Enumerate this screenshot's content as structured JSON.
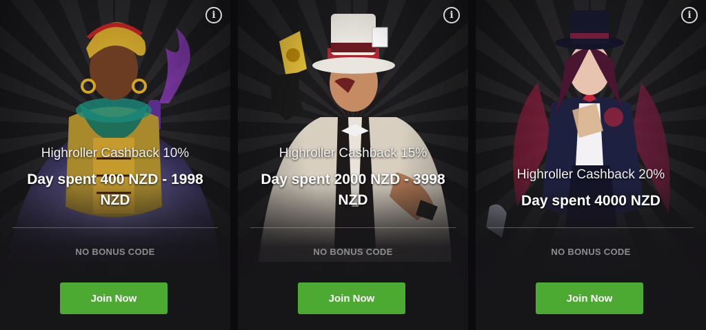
{
  "cards": [
    {
      "subtitle": "Highroller Cashback 10%",
      "title": "Day spent 400 NZD - 1998 NZD",
      "code_label": "NO BONUS CODE",
      "button_label": "Join Now",
      "info_icon": "i"
    },
    {
      "subtitle": "Highroller Cashback 15%",
      "title": "Day spent 2000 NZD - 3998 NZD",
      "code_label": "NO BONUS CODE",
      "button_label": "Join Now",
      "info_icon": "i"
    },
    {
      "subtitle": "Highroller Cashback 20%",
      "title": "Day spent 4000 NZD",
      "code_label": "NO BONUS CODE",
      "button_label": "Join Now",
      "info_icon": "i"
    }
  ],
  "colors": {
    "card_bg": "#1b1a1d",
    "button": "#4caa33",
    "code_text": "#8e8e8e"
  }
}
